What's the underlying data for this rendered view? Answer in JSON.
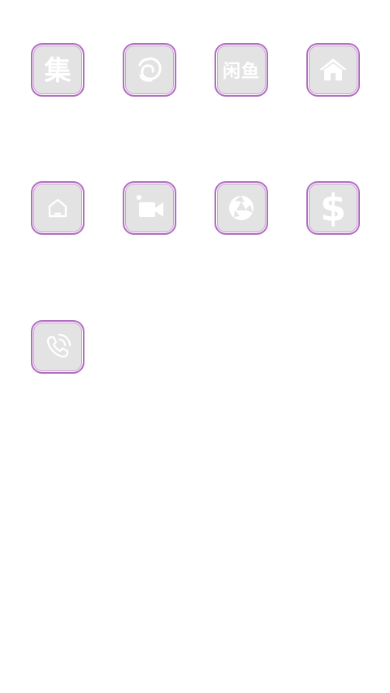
{
  "apps": [
    {
      "name": "ji-app",
      "glyph": "集",
      "icon": "ji-character-icon"
    },
    {
      "name": "swirl-app",
      "glyph": "",
      "icon": "swirl-icon"
    },
    {
      "name": "text-logo-app",
      "glyph": "闲鱼",
      "icon": "text-logo-icon"
    },
    {
      "name": "home-app",
      "glyph": "",
      "icon": "house-icon"
    },
    {
      "name": "smart-home-app",
      "glyph": "",
      "icon": "outline-house-icon"
    },
    {
      "name": "video-camera-app",
      "glyph": "",
      "icon": "video-camera-icon"
    },
    {
      "name": "aperture-app",
      "glyph": "",
      "icon": "aperture-icon"
    },
    {
      "name": "dollar-app",
      "glyph": "$",
      "icon": "dollar-icon"
    },
    {
      "name": "phone-app",
      "glyph": "",
      "icon": "phone-call-icon"
    }
  ],
  "colors": {
    "tile_background": "#e3e3e3",
    "tile_border": "#b16fc0",
    "glyph": "#ffffff",
    "page_background": "#ffffff"
  }
}
